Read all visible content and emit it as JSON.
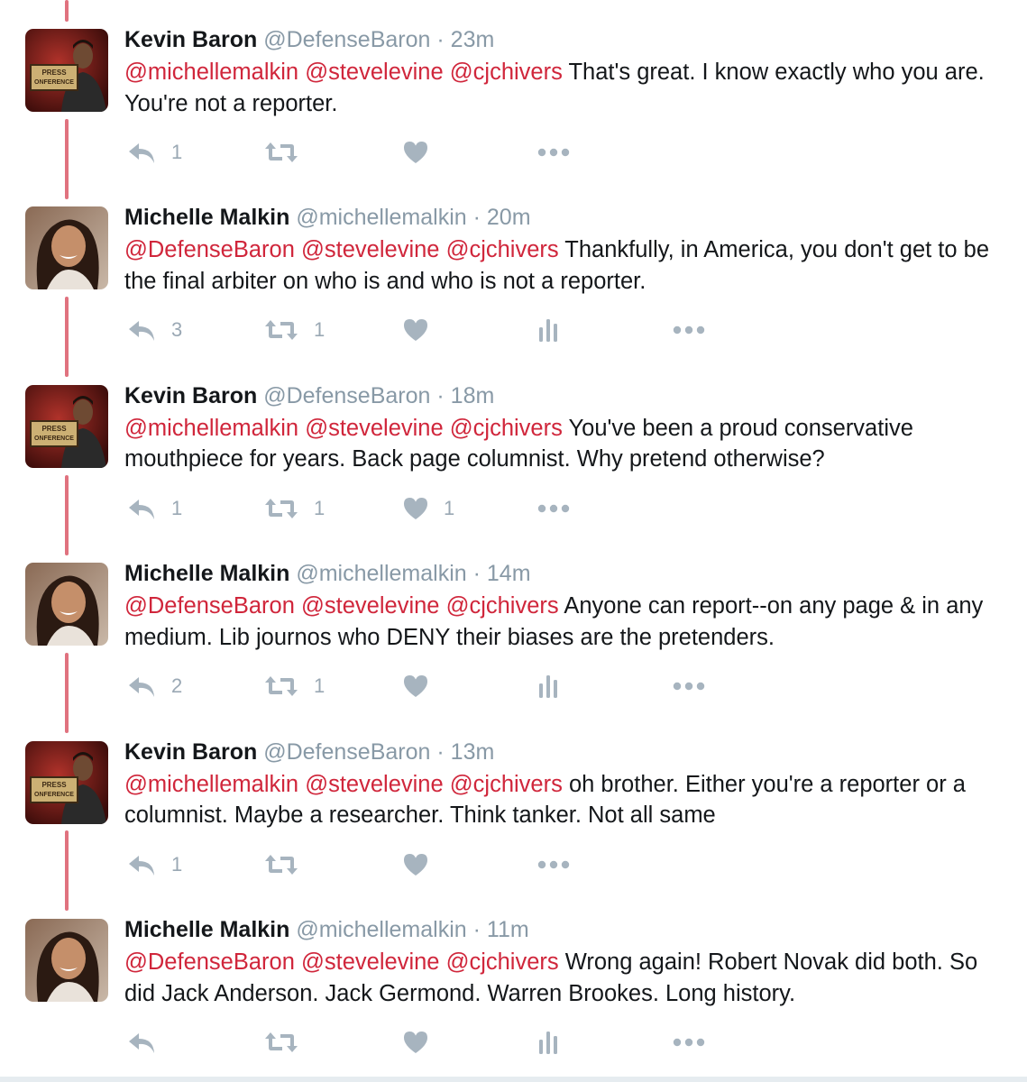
{
  "colors": {
    "mention": "#d0263b",
    "thread_line": "#e0727f",
    "meta": "#8899a6",
    "action_icon": "#a7b4bf"
  },
  "tweets": [
    {
      "name": "Kevin Baron",
      "handle": "@DefenseBaron",
      "separator": "·",
      "time": "23m",
      "avatar": "kevin",
      "avatar_sign": [
        "PRESS",
        "ONFERENCE"
      ],
      "mentions": [
        "@michellemalkin",
        "@stevelevine",
        "@cjchivers"
      ],
      "body": " That's great. I know exactly who you are. You're not a reporter.",
      "replies": "1",
      "retweets": "",
      "likes": "",
      "show_analytics": false
    },
    {
      "name": "Michelle Malkin",
      "handle": "@michellemalkin",
      "separator": "·",
      "time": "20m",
      "avatar": "michelle",
      "mentions": [
        "@DefenseBaron",
        "@stevelevine",
        "@cjchivers"
      ],
      "body": "Thankfully, in America, you don't get to be the final arbiter on who is and who is not a reporter.",
      "replies": "3",
      "retweets": "1",
      "likes": "",
      "show_analytics": true
    },
    {
      "name": "Kevin Baron",
      "handle": "@DefenseBaron",
      "separator": "·",
      "time": "18m",
      "avatar": "kevin",
      "avatar_sign": [
        "PRESS",
        "ONFERENCE"
      ],
      "mentions": [
        "@michellemalkin",
        "@stevelevine",
        "@cjchivers"
      ],
      "body": "You've been a proud conservative mouthpiece for years. Back page columnist. Why pretend otherwise?",
      "replies": "1",
      "retweets": "1",
      "likes": "1",
      "show_analytics": false
    },
    {
      "name": "Michelle Malkin",
      "handle": "@michellemalkin",
      "separator": "·",
      "time": "14m",
      "avatar": "michelle",
      "mentions": [
        "@DefenseBaron",
        "@stevelevine",
        "@cjchivers"
      ],
      "body": "Anyone can report--on any page & in any medium. Lib journos who DENY their biases are the pretenders.",
      "replies": "2",
      "retweets": "1",
      "likes": "",
      "show_analytics": true
    },
    {
      "name": "Kevin Baron",
      "handle": "@DefenseBaron",
      "separator": "·",
      "time": "13m",
      "avatar": "kevin",
      "avatar_sign": [
        "PRESS",
        "ONFERENCE"
      ],
      "mentions": [
        "@michellemalkin",
        "@stevelevine",
        "@cjchivers"
      ],
      "body": " oh brother. Either you're a reporter or a columnist. Maybe a researcher. Think tanker. Not all same",
      "replies": "1",
      "retweets": "",
      "likes": "",
      "show_analytics": false
    },
    {
      "name": "Michelle Malkin",
      "handle": "@michellemalkin",
      "separator": "·",
      "time": "11m",
      "avatar": "michelle",
      "mentions": [
        "@DefenseBaron",
        "@stevelevine",
        "@cjchivers"
      ],
      "body": "Wrong again! Robert Novak did both. So did Jack Anderson. Jack Germond. Warren Brookes. Long history.",
      "replies": "",
      "retweets": "",
      "likes": "",
      "show_analytics": true
    }
  ]
}
